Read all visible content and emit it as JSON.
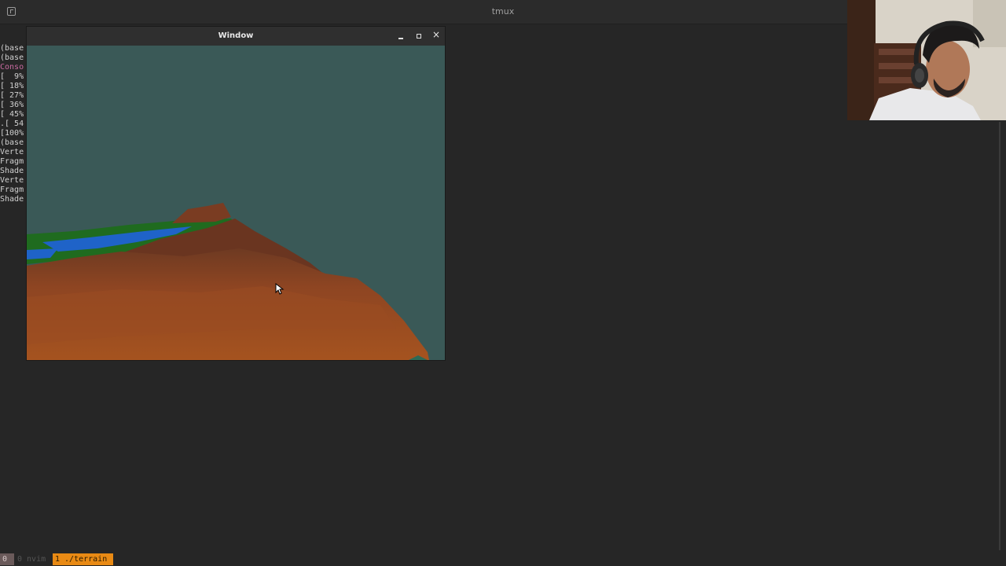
{
  "app": {
    "title": "tmux"
  },
  "terminal": {
    "lines": [
      {
        "text": "(base",
        "style": "normal"
      },
      {
        "text": "(base",
        "style": "normal"
      },
      {
        "text": "Conso",
        "style": "magenta"
      },
      {
        "text": "[  9%",
        "style": "normal"
      },
      {
        "text": "[ 18%",
        "style": "normal"
      },
      {
        "text": "[ 27%",
        "style": "normal"
      },
      {
        "text": "[ 36%",
        "style": "normal"
      },
      {
        "text": "[ 45%",
        "style": "normal"
      },
      {
        "text": ".[ 54",
        "style": "normal"
      },
      {
        "text": "[100%",
        "style": "normal"
      },
      {
        "text": "(base",
        "style": "normal"
      },
      {
        "text": "Verte",
        "style": "normal"
      },
      {
        "text": "Fragm",
        "style": "normal"
      },
      {
        "text": "Shade",
        "style": "normal"
      },
      {
        "text": "Verte",
        "style": "normal"
      },
      {
        "text": "Fragm",
        "style": "normal"
      },
      {
        "text": "Shade",
        "style": "normal"
      }
    ]
  },
  "window": {
    "title": "Window",
    "buttons": {
      "minimize": "minimize-icon",
      "maximize": "maximize-icon",
      "close": "close-icon"
    },
    "scene": {
      "sky_color": "#3a5957",
      "terrain_color": "#9c4a22",
      "water_color": "#1f63c8",
      "grass_color": "#1f6b1f"
    }
  },
  "statusbar": {
    "session": "0",
    "windows": [
      {
        "index": "0",
        "name": "nvim",
        "label": "0 nvim",
        "active": false
      },
      {
        "index": "1",
        "name": "./terrain",
        "label": "1 ./terrain",
        "active": true
      }
    ],
    "active_color": "#e98a14"
  },
  "icons": {
    "app": "terminal-app-icon",
    "cursor": "mouse-pointer-icon"
  }
}
